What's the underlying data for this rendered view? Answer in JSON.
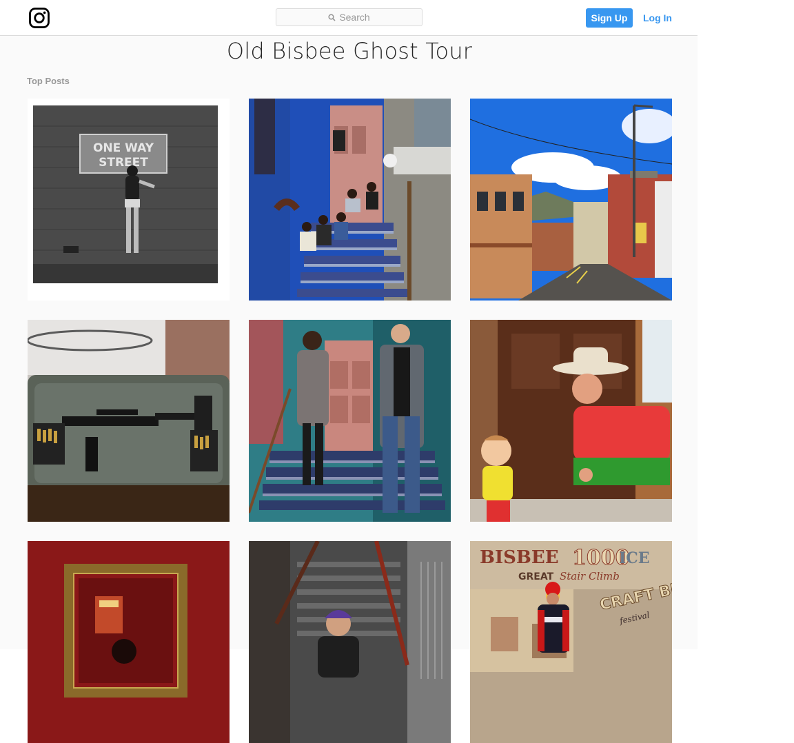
{
  "header": {
    "search_placeholder": "Search",
    "signup_label": "Sign Up",
    "login_label": "Log In"
  },
  "page": {
    "title": "Old Bisbee Ghost Tour",
    "section_label": "Top Posts"
  },
  "posts": [
    {
      "name": "post-one-way-street",
      "photo_text": "ONE WAY STREET"
    },
    {
      "name": "post-blue-stairs-group"
    },
    {
      "name": "post-bisbee-main-street"
    },
    {
      "name": "post-rifle-on-bag"
    },
    {
      "name": "post-couple-on-stairs"
    },
    {
      "name": "post-cowboy-and-child"
    },
    {
      "name": "post-red-frame-wall"
    },
    {
      "name": "post-purple-hair-stairs"
    },
    {
      "name": "post-bisbee-1000-mural",
      "photo_text": "BISBEE 1000 ICE GREAT Stair Climb CRAFT BE festival"
    }
  ],
  "colors": {
    "brand_blue": "#3897f0",
    "border": "#dbdbdb",
    "background": "#fafafa"
  }
}
